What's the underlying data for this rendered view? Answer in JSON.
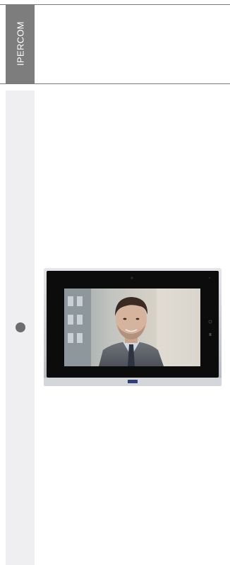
{
  "brand": {
    "tab_label": "IPERCOM"
  },
  "product": {
    "name": "video-intercom-monitor",
    "frame_color": "#c9ccd1",
    "bezel_color": "#0c0c0d"
  },
  "colors": {
    "rule": "#7a7a7a",
    "tab_bg": "#7d7d7d",
    "sidebar_bg": "#efeff1",
    "bullet": "#6d6d6d"
  }
}
